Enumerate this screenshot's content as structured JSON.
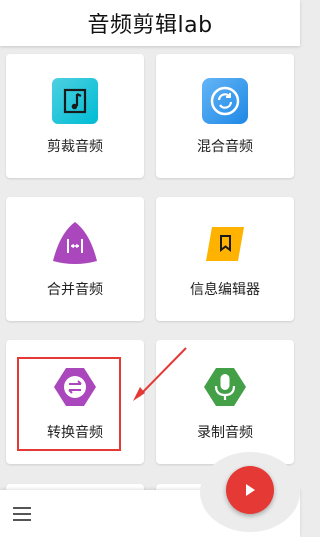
{
  "app": {
    "title": "音频剪辑lab"
  },
  "cards": [
    {
      "label": "剪裁音频",
      "icon": "music-note-icon",
      "color": "#26c6da"
    },
    {
      "label": "混合音频",
      "icon": "mix-circle-icon",
      "color": "#42a5f5"
    },
    {
      "label": "合并音频",
      "icon": "merge-icon",
      "color": "#ab47bc"
    },
    {
      "label": "信息编辑器",
      "icon": "tag-edit-icon",
      "color": "#ffb300"
    },
    {
      "label": "转换音频",
      "icon": "convert-arrows-icon",
      "color": "#ab47bc"
    },
    {
      "label": "录制音频",
      "icon": "microphone-icon",
      "color": "#43a047"
    }
  ],
  "bottom_bar": {
    "menu_icon": "hamburger-menu-icon",
    "fab_icon": "play-icon",
    "fab_color": "#e53935"
  },
  "annotation": {
    "highlight_color": "#e53935"
  }
}
